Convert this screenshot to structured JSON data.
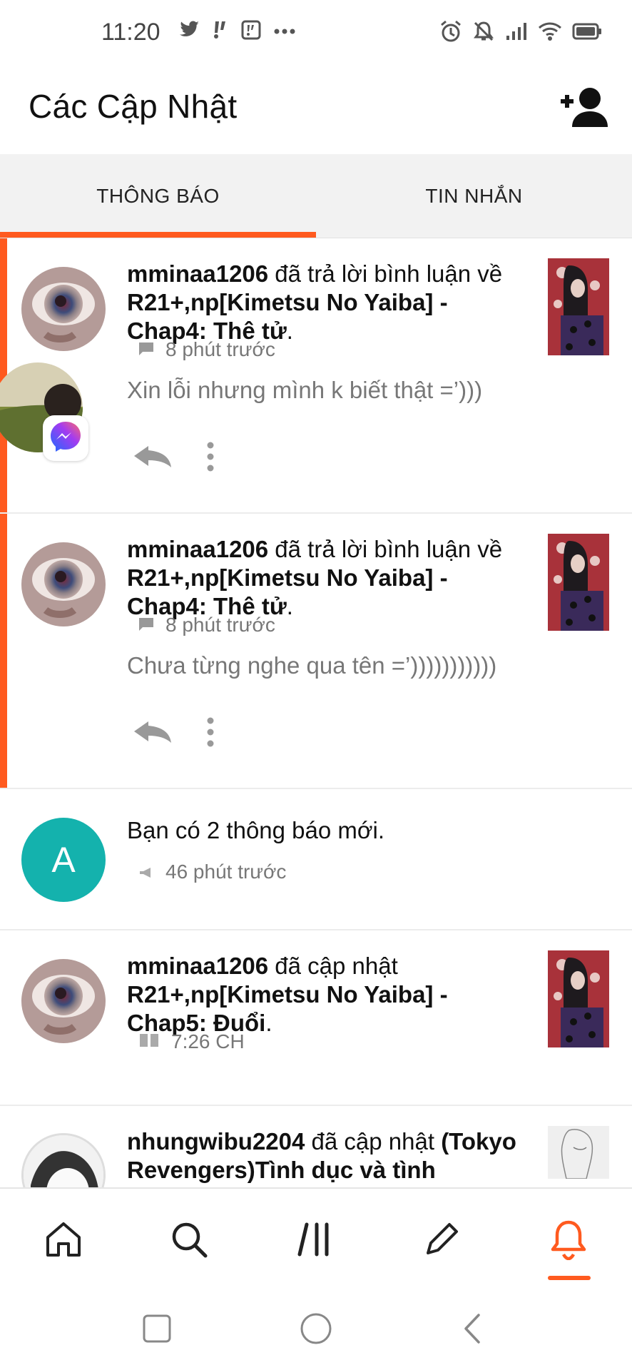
{
  "status_bar": {
    "time": "11:20",
    "left_icons": [
      "twitter-icon",
      "notification-app-icon",
      "notification-app-icon",
      "more-dots-icon"
    ],
    "right_icons": [
      "alarm-icon",
      "mute-icon",
      "signal-icon",
      "wifi-icon",
      "battery-icon"
    ]
  },
  "header": {
    "title": "Các Cập Nhật",
    "action_icon": "add-user-icon"
  },
  "tabs": [
    {
      "label": "THÔNG BÁO",
      "active": true
    },
    {
      "label": "TIN NHẮN",
      "active": false
    }
  ],
  "colors": {
    "accent": "#ff5a1f",
    "teal_avatar": "#14b2ad",
    "meta_text": "#777777"
  },
  "notifications": [
    {
      "user": "mminaa1206",
      "action": " đã trả lời bình luận về ",
      "story": "R21+,np[Kimetsu No Yaiba] - Chap4: Thê tử",
      "end": ".",
      "time": "8 phút trước",
      "time_icon": "comment-icon",
      "comment": "Xin lỗi nhưng mình k biết thật =’)))",
      "unread": true
    },
    {
      "user": "mminaa1206",
      "action": " đã trả lời bình luận về ",
      "story": "R21+,np[Kimetsu No Yaiba] - Chap4: Thê tử",
      "end": ".",
      "time": "8 phút trước",
      "time_icon": "comment-icon",
      "comment": "Chưa từng nghe qua tên =’)))))))))))",
      "unread": true
    },
    {
      "avatar_letter": "A",
      "text": "Bạn có 2 thông báo mới.",
      "time": "46 phút trước",
      "time_icon": "megaphone-icon"
    },
    {
      "user": "mminaa1206",
      "action": " đã cập nhật ",
      "story": "R21+,np[Kimetsu No Yaiba] - Chap5: Đuổi",
      "end": ".",
      "time": "7:26 CH",
      "time_icon": "book-icon"
    },
    {
      "user": "nhungwibu2204",
      "action": " đã cập nhật ",
      "story": "(Tokyo Revengers)Tình dục và tình yêu[H+]"
    }
  ],
  "bottom_nav": [
    "home-icon",
    "search-icon",
    "library-icon",
    "write-icon",
    "notifications-icon"
  ],
  "system_nav": [
    "recent-apps-icon",
    "home-circle-icon",
    "back-icon"
  ]
}
